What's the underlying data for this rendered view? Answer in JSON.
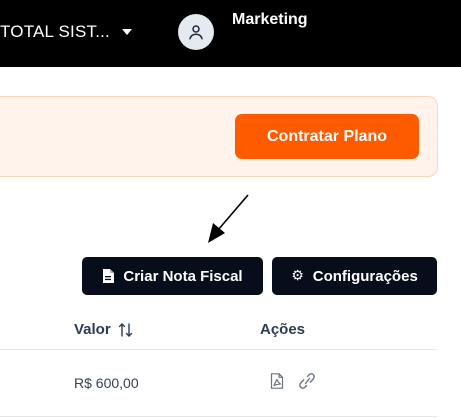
{
  "header": {
    "company_name": "TOTAL SIST...",
    "user_name": "Marketing",
    "icons": {
      "avatar": "user-icon",
      "company_dropdown": "caret-down-icon"
    }
  },
  "plan_banner": {
    "cta_label": "Contratar Plano",
    "cta_color": "#fe5a00",
    "background_color": "#fff3ec"
  },
  "toolbar": {
    "create_invoice_label": "Criar Nota Fiscal",
    "settings_label": "Configurações",
    "button_color": "#070d1a",
    "icons": {
      "create_invoice": "document-icon",
      "settings": "gear-icon"
    }
  },
  "table": {
    "columns": [
      {
        "label": "Valor",
        "sortable": true
      },
      {
        "label": "Ações",
        "sortable": false
      }
    ],
    "rows": [
      {
        "valor": "R$ 600,00",
        "acoes": [
          "pdf-icon",
          "link-icon"
        ]
      }
    ]
  }
}
